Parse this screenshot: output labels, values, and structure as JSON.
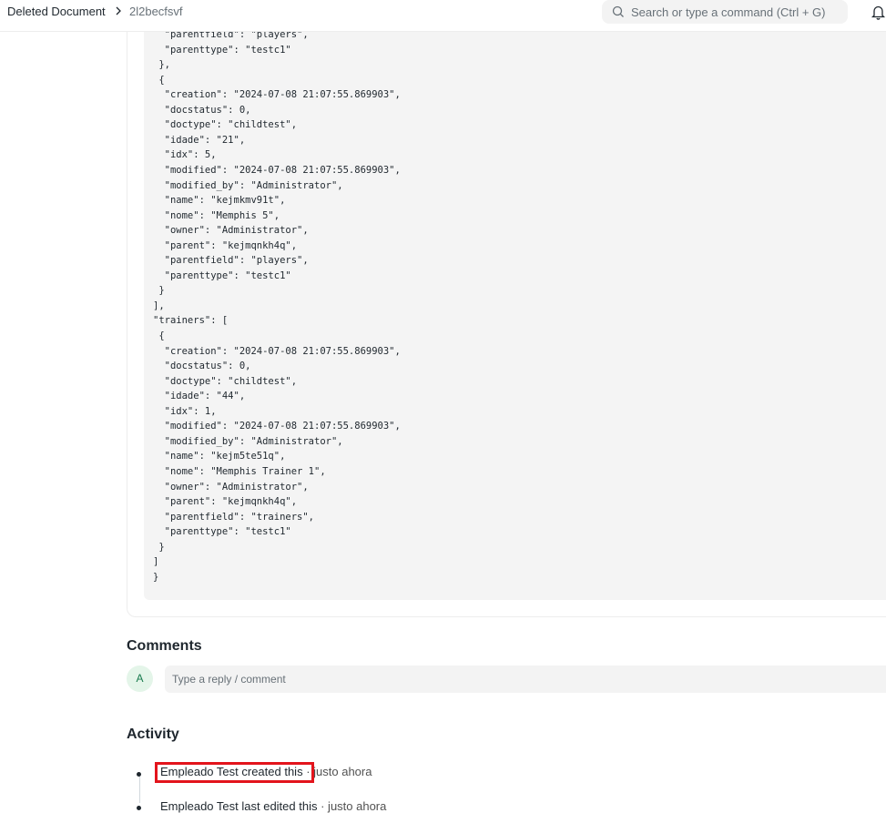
{
  "breadcrumb": {
    "doctype": "Deleted Document",
    "docname": "2l2becfsvf"
  },
  "search": {
    "placeholder": "Search or type a command (Ctrl + G)"
  },
  "icons": {
    "search": "search-icon",
    "bell": "bell-icon",
    "chevron": "chevron-right-icon"
  },
  "code_lines": [
    "  \"parentfield\": \"players\",",
    "  \"parenttype\": \"testc1\"",
    " },",
    " {",
    "  \"creation\": \"2024-07-08 21:07:55.869903\",",
    "  \"docstatus\": 0,",
    "  \"doctype\": \"childtest\",",
    "  \"idade\": \"21\",",
    "  \"idx\": 5,",
    "  \"modified\": \"2024-07-08 21:07:55.869903\",",
    "  \"modified_by\": \"Administrator\",",
    "  \"name\": \"kejmkmv91t\",",
    "  \"nome\": \"Memphis 5\",",
    "  \"owner\": \"Administrator\",",
    "  \"parent\": \"kejmqnkh4q\",",
    "  \"parentfield\": \"players\",",
    "  \"parenttype\": \"testc1\"",
    " }",
    "],",
    "\"trainers\": [",
    " {",
    "  \"creation\": \"2024-07-08 21:07:55.869903\",",
    "  \"docstatus\": 0,",
    "  \"doctype\": \"childtest\",",
    "  \"idade\": \"44\",",
    "  \"idx\": 1,",
    "  \"modified\": \"2024-07-08 21:07:55.869903\",",
    "  \"modified_by\": \"Administrator\",",
    "  \"name\": \"kejm5te51q\",",
    "  \"nome\": \"Memphis Trainer 1\",",
    "  \"owner\": \"Administrator\",",
    "  \"parent\": \"kejmqnkh4q\",",
    "  \"parentfield\": \"trainers\",",
    "  \"parenttype\": \"testc1\"",
    " }",
    "]",
    "}"
  ],
  "comments": {
    "title": "Comments",
    "avatar_letter": "A",
    "placeholder": "Type a reply / comment"
  },
  "activity": {
    "title": "Activity",
    "items": [
      {
        "text": "Empleado Test created this",
        "time": "· justo ahora"
      },
      {
        "text": "Empleado Test last edited this",
        "time": "· justo ahora"
      }
    ]
  }
}
